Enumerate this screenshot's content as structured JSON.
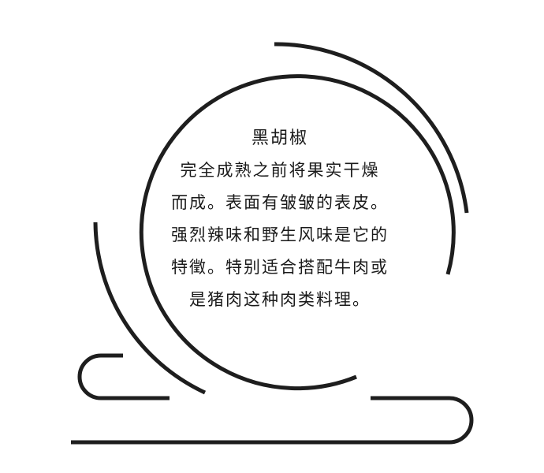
{
  "card": {
    "title": "黑胡椒",
    "lines": [
      "完全成熟之前将果实干燥",
      "而成。表面有皱皱的表皮。",
      "强烈辣味和野生风味是它的",
      "特徵。特别适合搭配牛肉或",
      "是猪肉这种肉类料理。"
    ]
  },
  "colors": {
    "stroke": "#1e1e1e",
    "background": "#ffffff",
    "text": "#1a1a1a"
  }
}
